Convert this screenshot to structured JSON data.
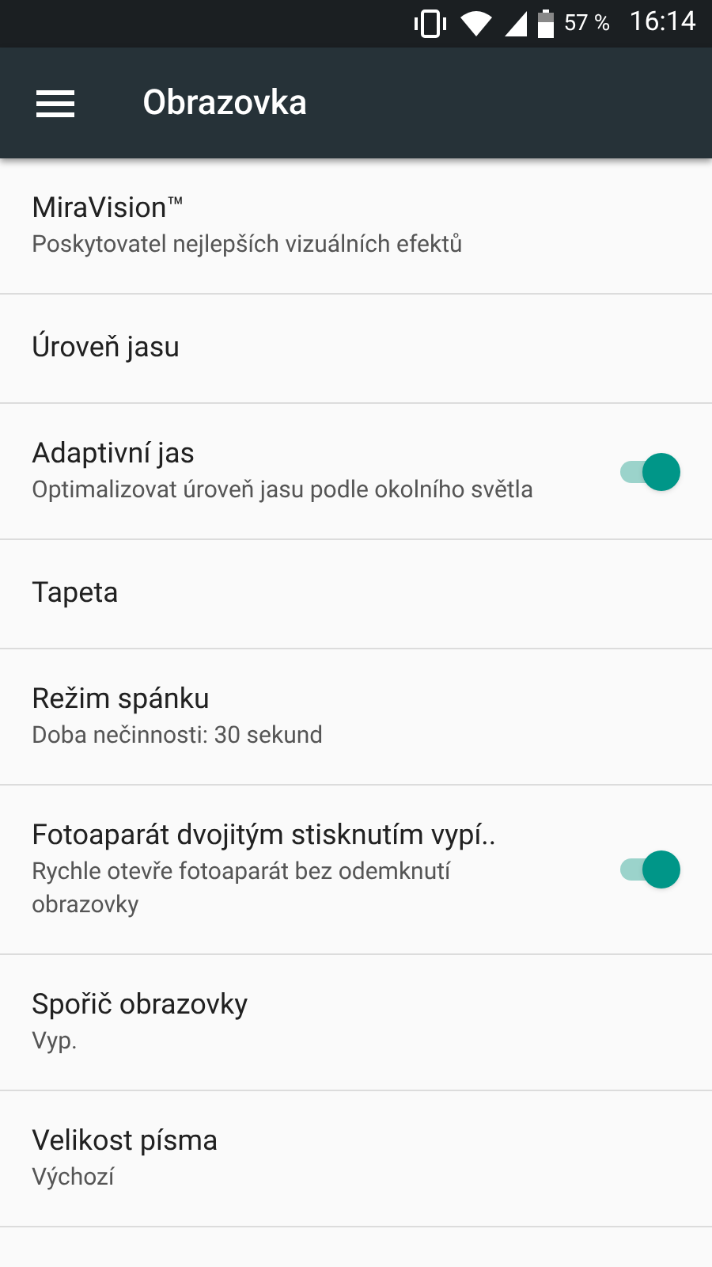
{
  "status_bar": {
    "battery": "57 %",
    "time": "16:14"
  },
  "app_bar": {
    "title": "Obrazovka"
  },
  "settings": [
    {
      "title": "MiraVision™",
      "summary": "Poskytovatel nejlepších vizuálních efektů"
    },
    {
      "title": "Úroveň jasu"
    },
    {
      "title": "Adaptivní jas",
      "summary": "Optimalizovat úroveň jasu podle okolního světla",
      "kind": "switch",
      "on": true
    },
    {
      "title": "Tapeta"
    },
    {
      "title": "Režim spánku",
      "summary": "Doba nečinnosti: 30 sekund"
    },
    {
      "title": "Fotoaparát dvojitým stisknutím vypí..",
      "summary": "Rychle otevře fotoaparát bez odemknutí obrazovky",
      "kind": "switch",
      "on": true
    },
    {
      "title": "Spořič obrazovky",
      "summary": "Vyp."
    },
    {
      "title": "Velikost písma",
      "summary": "Výchozí"
    }
  ]
}
